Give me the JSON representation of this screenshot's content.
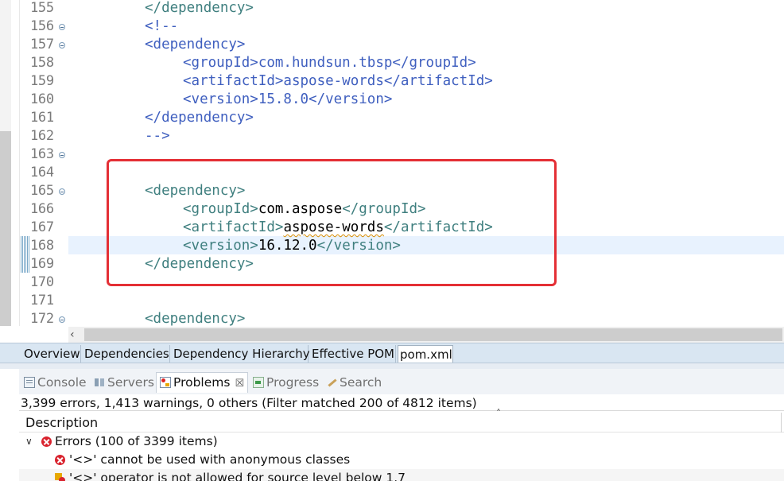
{
  "editor": {
    "lines": [
      {
        "num": "155",
        "indent": 0,
        "parts": [
          [
            "tag",
            "</dependency>"
          ]
        ],
        "fold": false
      },
      {
        "num": "156",
        "indent": 0,
        "parts": [
          [
            "cmt",
            "<!--"
          ]
        ],
        "fold": true
      },
      {
        "num": "157",
        "indent": 0,
        "parts": [
          [
            "cmt",
            "<dependency>"
          ]
        ],
        "fold": true
      },
      {
        "num": "158",
        "indent": 1,
        "parts": [
          [
            "cmt",
            "<groupId>com.hundsun.tbsp</groupId>"
          ]
        ],
        "fold": false
      },
      {
        "num": "159",
        "indent": 1,
        "parts": [
          [
            "cmt",
            "<artifactId>aspose-words</artifactId>"
          ]
        ],
        "fold": false
      },
      {
        "num": "160",
        "indent": 1,
        "parts": [
          [
            "cmt",
            "<version>15.8.0</version>"
          ]
        ],
        "fold": false
      },
      {
        "num": "161",
        "indent": 0,
        "parts": [
          [
            "cmt",
            "</dependency>"
          ]
        ],
        "fold": false
      },
      {
        "num": "162",
        "indent": 0,
        "parts": [
          [
            "cmt",
            "-->"
          ]
        ],
        "fold": false
      },
      {
        "num": "163",
        "indent": 0,
        "parts": [],
        "fold": true
      },
      {
        "num": "164",
        "indent": 0,
        "parts": [],
        "fold": false
      },
      {
        "num": "165",
        "indent": 0,
        "parts": [
          [
            "tag",
            "<dependency>"
          ]
        ],
        "fold": true
      },
      {
        "num": "166",
        "indent": 1,
        "parts": [
          [
            "tag",
            "<groupId>"
          ],
          [
            "txt",
            "com.aspose"
          ],
          [
            "tag",
            "</groupId>"
          ]
        ],
        "fold": false
      },
      {
        "num": "167",
        "indent": 1,
        "parts": [
          [
            "tag",
            "<artifactId>"
          ],
          [
            "txt sq",
            "aspose-words"
          ],
          [
            "tag",
            "</artifactId>"
          ]
        ],
        "fold": false
      },
      {
        "num": "168",
        "indent": 1,
        "parts": [
          [
            "tag",
            "<version>"
          ],
          [
            "txt",
            "16.12.0"
          ],
          [
            "tag",
            "</version>"
          ]
        ],
        "fold": false
      },
      {
        "num": "169",
        "indent": 0,
        "parts": [
          [
            "tag",
            "</dependency>"
          ]
        ],
        "fold": false
      },
      {
        "num": "170",
        "indent": 0,
        "parts": [],
        "fold": false
      },
      {
        "num": "171",
        "indent": 0,
        "parts": [],
        "fold": false
      },
      {
        "num": "172",
        "indent": 0,
        "parts": [
          [
            "tag",
            "<dependency>"
          ]
        ],
        "fold": true
      }
    ],
    "current_line": "168",
    "changed_lines": [
      "168",
      "169"
    ]
  },
  "pom_tabs": [
    "Overview",
    "Dependencies",
    "Dependency Hierarchy",
    "Effective POM",
    "pom.xml"
  ],
  "pom_active_tab": "pom.xml",
  "view_tabs": {
    "console": "Console",
    "servers": "Servers",
    "problems": "Problems",
    "progress": "Progress",
    "search": "Search",
    "close": "☒"
  },
  "problems": {
    "summary": "3,399 errors, 1,413 warnings, 0 others (Filter matched 200 of 4812 items)",
    "column_header": "Description",
    "errors_group": "Errors (100 of 3399 items)",
    "items": [
      "'<>' cannot be used with anonymous classes",
      "'<>' operator is not allowed for source level below 1.7"
    ]
  },
  "colors": {
    "tag": "#3f7f7f",
    "comment": "#3f5fbf",
    "highlight_box": "#e42f35",
    "error": "#d9232e"
  }
}
